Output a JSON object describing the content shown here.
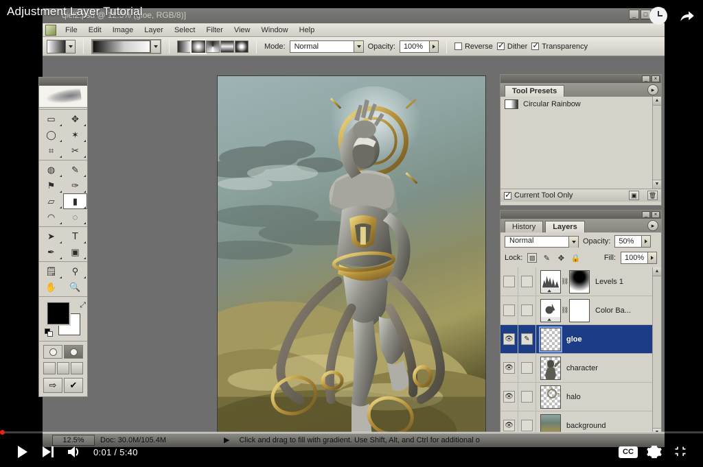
{
  "video": {
    "title": "Adjustment Layer Tutorial",
    "current_time": "0:01",
    "duration": "5:40",
    "time_display": "0:01 / 5:40",
    "progress_percent": 0.3,
    "watch_later_icon": "clock-icon",
    "share_icon": "share-arrow-icon",
    "play_icon": "play-icon",
    "next_icon": "next-track-icon",
    "volume_icon": "volume-icon",
    "captions_label": "CC",
    "settings_icon": "gear-icon",
    "fullscreen_icon": "exit-fullscreen-icon",
    "accent_color": "#e62117"
  },
  "app": {
    "title": "qiel2.psd @ 12.5% (gloe, RGB/8)]",
    "window_buttons": [
      "_",
      "□",
      "×"
    ],
    "doc_window_buttons": [
      "_",
      "□",
      "×"
    ],
    "menus": [
      "File",
      "Edit",
      "Image",
      "Layer",
      "Select",
      "Filter",
      "View",
      "Window",
      "Help"
    ],
    "logo_icon": "photoshop-icon"
  },
  "options_bar": {
    "tool_preset_icon": "gradient-preset-swatch",
    "gradient_picker_icon": "gradient-sample",
    "gradient_types": [
      {
        "name": "linear-gradient-button",
        "active": false
      },
      {
        "name": "radial-gradient-button",
        "active": true
      },
      {
        "name": "angle-gradient-button",
        "active": false
      },
      {
        "name": "reflected-gradient-button",
        "active": false
      },
      {
        "name": "diamond-gradient-button",
        "active": false
      }
    ],
    "mode_label": "Mode:",
    "mode_value": "Normal",
    "opacity_label": "Opacity:",
    "opacity_value": "100%",
    "reverse_label": "Reverse",
    "reverse_checked": false,
    "dither_label": "Dither",
    "dither_checked": true,
    "transparency_label": "Transparency",
    "transparency_checked": true
  },
  "toolbox": {
    "tools": [
      {
        "name": "marquee-tool",
        "glyph": "▭"
      },
      {
        "name": "move-tool",
        "glyph": "✥"
      },
      {
        "name": "lasso-tool",
        "glyph": "◯"
      },
      {
        "name": "magic-wand-tool",
        "glyph": "✶"
      },
      {
        "name": "crop-tool",
        "glyph": "⌗"
      },
      {
        "name": "slice-tool",
        "glyph": "✂"
      },
      {
        "name": "healing-brush-tool",
        "glyph": "◍"
      },
      {
        "name": "brush-tool",
        "glyph": "✎"
      },
      {
        "name": "clone-stamp-tool",
        "glyph": "⚑"
      },
      {
        "name": "history-brush-tool",
        "glyph": "✑"
      },
      {
        "name": "eraser-tool",
        "glyph": "▱"
      },
      {
        "name": "gradient-tool",
        "glyph": "▮",
        "selected": true
      },
      {
        "name": "blur-tool",
        "glyph": "◠"
      },
      {
        "name": "dodge-tool",
        "glyph": "◌"
      },
      {
        "name": "path-selection-tool",
        "glyph": "➤"
      },
      {
        "name": "type-tool",
        "glyph": "T"
      },
      {
        "name": "pen-tool",
        "glyph": "✒"
      },
      {
        "name": "shape-tool",
        "glyph": "▣"
      },
      {
        "name": "notes-tool",
        "glyph": "🗒"
      },
      {
        "name": "eyedropper-tool",
        "glyph": "⚲"
      },
      {
        "name": "hand-tool",
        "glyph": "✋"
      },
      {
        "name": "zoom-tool",
        "glyph": "🔍"
      }
    ],
    "foreground_color": "#000000",
    "background_color": "#ffffff",
    "swap_icon": "swap-colors-icon",
    "quickmask_icons": [
      "standard-mode-icon",
      "quick-mask-mode-icon"
    ],
    "screen_mode_icons": [
      "standard-screen-icon",
      "full-screen-menubar-icon",
      "full-screen-icon"
    ],
    "jump_icons": [
      "jump-to-imageready-icon",
      "imageready-icon"
    ]
  },
  "tool_presets": {
    "panel_title": "Tool Presets",
    "items": [
      {
        "label": "Circular Rainbow",
        "icon": "gradient-swatch"
      }
    ],
    "current_tool_only_label": "Current Tool Only",
    "current_tool_only_checked": true,
    "new_preset_icon": "new-preset-icon",
    "delete_preset_icon": "trash-icon",
    "panel_menu_icon": "panel-menu-icon"
  },
  "layers_panel": {
    "tabs": [
      {
        "label": "History",
        "active": false
      },
      {
        "label": "Layers",
        "active": true
      }
    ],
    "blend_mode": "Normal",
    "opacity_label": "Opacity:",
    "opacity_value": "50%",
    "lock_label": "Lock:",
    "lock_icons": [
      "lock-transparent-pixels-icon",
      "lock-image-pixels-icon",
      "lock-position-icon",
      "lock-all-icon"
    ],
    "fill_label": "Fill:",
    "fill_value": "100%",
    "panel_menu_icon": "panel-menu-icon",
    "layers": [
      {
        "name": "Levels 1",
        "visible": false,
        "linked": false,
        "selected": false,
        "thumb": "levels-histogram",
        "has_mask": true,
        "mask": "black-radial-mask"
      },
      {
        "name": "Color Ba...",
        "visible": false,
        "linked": false,
        "selected": false,
        "thumb": "color-balance",
        "has_mask": true,
        "mask": "white-mask"
      },
      {
        "name": "gloe",
        "visible": true,
        "linked": true,
        "selected": true,
        "thumb": "checker",
        "has_mask": false
      },
      {
        "name": "character",
        "visible": true,
        "linked": false,
        "selected": false,
        "thumb": "character-art",
        "has_mask": false
      },
      {
        "name": "halo",
        "visible": true,
        "linked": false,
        "selected": false,
        "thumb": "halo-art",
        "has_mask": false
      },
      {
        "name": "background",
        "visible": true,
        "linked": false,
        "selected": false,
        "thumb": "background-art",
        "has_mask": false
      }
    ],
    "footer_icons": [
      "link-layers-icon",
      "layer-style-icon",
      "add-mask-icon",
      "new-group-icon",
      "new-adjustment-layer-icon",
      "new-layer-icon",
      "delete-layer-icon"
    ]
  },
  "status_bar": {
    "zoom": "12.5%",
    "doc_info": "Doc: 30.0M/105.4M",
    "hint": "Click and drag to fill with gradient.  Use Shift, Alt, and Ctrl for additional o",
    "expand_icon": "status-arrow-icon"
  }
}
